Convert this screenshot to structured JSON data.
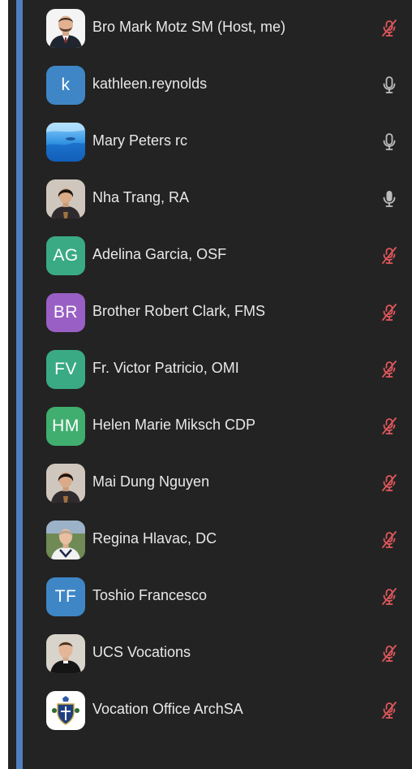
{
  "colors": {
    "panel_bg": "#232323",
    "accent_bar": "#4f7fc0",
    "name_text": "#e8e8e8",
    "muted_mic": "#e0575c",
    "live_mic": "#bdbdbd"
  },
  "participants": [
    {
      "name": "Bro Mark Motz SM (Host, me)",
      "avatar_type": "photo",
      "avatar_icon": "man-in-suit-photo",
      "mic_state": "muted",
      "mic_icon": "mic-muted-icon"
    },
    {
      "name": "kathleen.reynolds",
      "avatar_type": "initials",
      "initials": "k",
      "avatar_color": "#3f86c6",
      "mic_state": "unmuted",
      "mic_icon": "mic-icon"
    },
    {
      "name": "Mary Peters rc",
      "avatar_type": "photo",
      "avatar_icon": "ocean-photo",
      "mic_state": "unmuted",
      "mic_icon": "mic-icon"
    },
    {
      "name": "Nha Trang, RA",
      "avatar_type": "photo",
      "avatar_icon": "woman-photo",
      "mic_state": "speaking",
      "mic_icon": "mic-filled-icon"
    },
    {
      "name": "Adelina Garcia, OSF",
      "avatar_type": "initials",
      "initials": "AG",
      "avatar_color": "#3aaa84",
      "mic_state": "muted",
      "mic_icon": "mic-muted-icon"
    },
    {
      "name": "Brother Robert Clark, FMS",
      "avatar_type": "initials",
      "initials": "BR",
      "avatar_color": "#9a5fc4",
      "mic_state": "muted",
      "mic_icon": "mic-muted-icon"
    },
    {
      "name": "Fr. Victor Patricio, OMI",
      "avatar_type": "initials",
      "initials": "FV",
      "avatar_color": "#3aaa84",
      "mic_state": "muted",
      "mic_icon": "mic-muted-icon"
    },
    {
      "name": "Helen Marie Miksch CDP",
      "avatar_type": "initials",
      "initials": "HM",
      "avatar_color": "#3fae6e",
      "mic_state": "muted",
      "mic_icon": "mic-muted-icon"
    },
    {
      "name": "Mai Dung Nguyen",
      "avatar_type": "photo",
      "avatar_icon": "woman-photo",
      "mic_state": "muted",
      "mic_icon": "mic-muted-icon"
    },
    {
      "name": "Regina Hlavac, DC",
      "avatar_type": "photo",
      "avatar_icon": "woman-outdoor-photo",
      "mic_state": "muted",
      "mic_icon": "mic-muted-icon"
    },
    {
      "name": "Toshio Francesco",
      "avatar_type": "initials",
      "initials": "TF",
      "avatar_color": "#3f86c6",
      "mic_state": "muted",
      "mic_icon": "mic-muted-icon"
    },
    {
      "name": "UCS Vocations",
      "avatar_type": "photo",
      "avatar_icon": "priest-photo",
      "mic_state": "muted",
      "mic_icon": "mic-muted-icon"
    },
    {
      "name": "Vocation Office ArchSA",
      "avatar_type": "photo",
      "avatar_icon": "archdiocese-crest-logo",
      "mic_state": "muted",
      "mic_icon": "mic-muted-icon"
    }
  ]
}
